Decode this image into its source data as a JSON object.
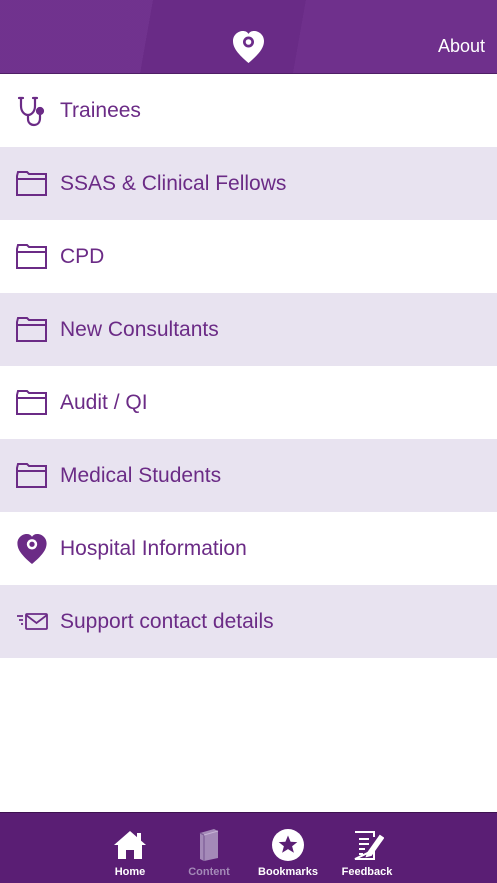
{
  "header": {
    "logo_icon": "heart-pin-icon",
    "about_label": "About"
  },
  "colors": {
    "header_bg": "#6c2c8a",
    "accent": "#6b2b86",
    "alt_row_bg": "#e8e3f0",
    "tabbar_bg": "#5a1e74",
    "inactive_tab": "#a48ab8"
  },
  "menu": {
    "items": [
      {
        "label": "Trainees",
        "icon": "stethoscope-icon"
      },
      {
        "label": "SSAS & Clinical Fellows",
        "icon": "folder-icon"
      },
      {
        "label": "CPD",
        "icon": "folder-icon"
      },
      {
        "label": "New Consultants",
        "icon": "folder-icon"
      },
      {
        "label": "Audit / QI",
        "icon": "folder-icon"
      },
      {
        "label": "Medical Students",
        "icon": "folder-icon"
      },
      {
        "label": "Hospital Information",
        "icon": "heart-pin-icon"
      },
      {
        "label": "Support contact details",
        "icon": "envelope-icon"
      }
    ]
  },
  "tabbar": {
    "tabs": [
      {
        "label": "Home",
        "icon": "home-icon",
        "active": true
      },
      {
        "label": "Content",
        "icon": "book-icon",
        "active": false
      },
      {
        "label": "Bookmarks",
        "icon": "star-icon",
        "active": true
      },
      {
        "label": "Feedback",
        "icon": "feedback-icon",
        "active": true
      }
    ]
  }
}
